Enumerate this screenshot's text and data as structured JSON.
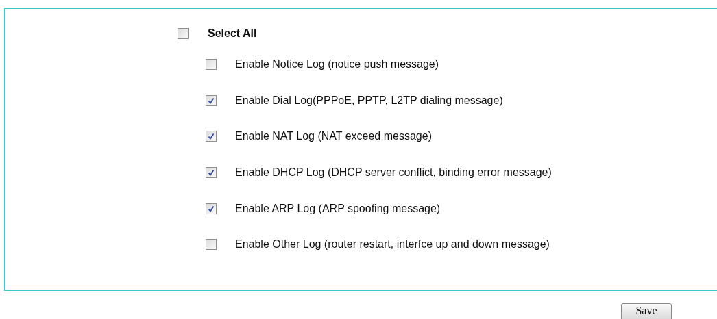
{
  "select_all": {
    "label": "Select All",
    "checked": false
  },
  "options": [
    {
      "label": "Enable Notice Log (notice push message)",
      "checked": false
    },
    {
      "label": "Enable Dial Log(PPPoE, PPTP, L2TP dialing message)",
      "checked": true
    },
    {
      "label": "Enable NAT Log (NAT exceed message)",
      "checked": true
    },
    {
      "label": "Enable DHCP Log (DHCP server conflict, binding error message)",
      "checked": true
    },
    {
      "label": "Enable ARP Log (ARP spoofing message)",
      "checked": true
    },
    {
      "label": "Enable Other Log (router restart, interfce up and down message)",
      "checked": false
    }
  ],
  "save_button": "Save"
}
